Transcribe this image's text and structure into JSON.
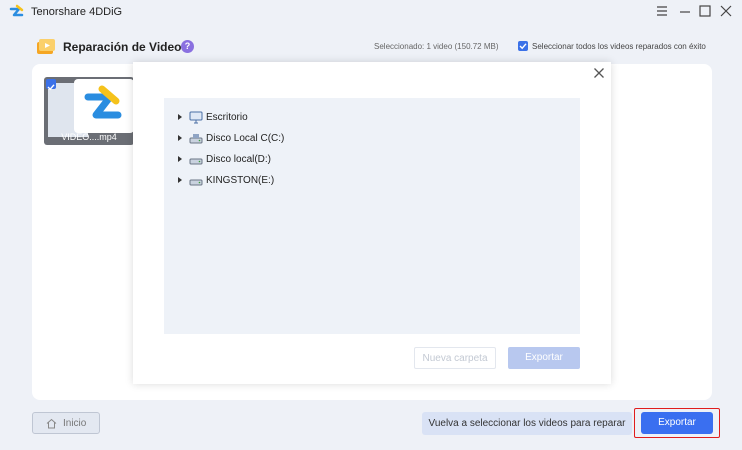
{
  "app": {
    "title": "Tenorshare 4DDiG"
  },
  "header": {
    "title": "Reparación de Videos",
    "help": "?",
    "selected_info": "Seleccionado: 1 video (150.72 MB)",
    "select_all_label": "Seleccionar todos los videos reparados con éxito",
    "select_all_checked": true
  },
  "video": {
    "name": "VIDEO....mp4",
    "checked": true
  },
  "dialog": {
    "tree": [
      {
        "label": "Escritorio",
        "icon": "desktop-icon"
      },
      {
        "label": "Disco Local C(C:)",
        "icon": "drive-icon"
      },
      {
        "label": "Disco local(D:)",
        "icon": "drive-icon"
      },
      {
        "label": "KINGSTON(E:)",
        "icon": "drive-icon"
      }
    ],
    "new_folder_label": "Nueva carpeta",
    "export_label": "Exportar"
  },
  "footer": {
    "home_label": "Inicio",
    "reselect_label": "Vuelva a seleccionar los videos para reparar",
    "export_label": "Exportar"
  },
  "colors": {
    "accent": "#3a6ff0",
    "highlight_border": "#e01d1d",
    "help_badge": "#8a70e0"
  }
}
